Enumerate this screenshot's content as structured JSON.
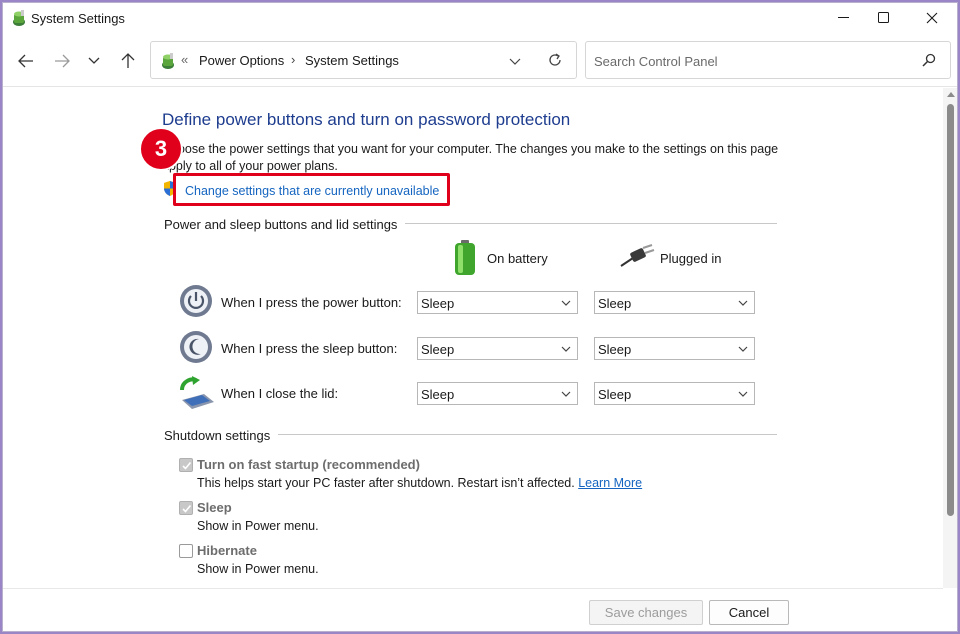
{
  "window": {
    "title": "System Settings",
    "minimize_icon": "minimize-icon",
    "maximize_icon": "maximize-icon",
    "close_icon": "close-icon"
  },
  "nav": {
    "back_icon": "arrow-left-icon",
    "forward_icon": "arrow-right-icon",
    "recent_icon": "chevron-down-icon",
    "up_icon": "arrow-up-icon",
    "address": {
      "overflow": "«",
      "crumbs": [
        "Power Options",
        "System Settings"
      ],
      "separator": "›"
    },
    "search_placeholder": "Search Control Panel"
  },
  "page": {
    "heading": "Define power buttons and turn on password protection",
    "intro": "Choose the power settings that you want for your computer. The changes you make to the settings on this page apply to all of your power plans.",
    "change_link": "Change settings that are currently unavailable",
    "step_badge": "3",
    "power_section": {
      "title": "Power and sleep buttons and lid settings",
      "columns": [
        "On battery",
        "Plugged in"
      ],
      "rows": [
        {
          "label": "When I press the power button:",
          "battery": "Sleep",
          "plugged": "Sleep",
          "icon": "power-button-icon"
        },
        {
          "label": "When I press the sleep button:",
          "battery": "Sleep",
          "plugged": "Sleep",
          "icon": "sleep-button-icon"
        },
        {
          "label": "When I close the lid:",
          "battery": "Sleep",
          "plugged": "Sleep",
          "icon": "laptop-lid-icon"
        }
      ]
    },
    "shutdown_section": {
      "title": "Shutdown settings",
      "items": [
        {
          "label": "Turn on fast startup (recommended)",
          "desc": "This helps start your PC faster after shutdown. Restart isn’t affected.",
          "link": "Learn More",
          "checked": true
        },
        {
          "label": "Sleep",
          "desc": "Show in Power menu.",
          "checked": true
        },
        {
          "label": "Hibernate",
          "desc": "Show in Power menu.",
          "checked": false
        }
      ]
    }
  },
  "footer": {
    "save_label": "Save changes",
    "cancel_label": "Cancel"
  },
  "colors": {
    "heading": "#1e3d8f",
    "link": "#1565c0",
    "highlight": "#e0001b"
  }
}
